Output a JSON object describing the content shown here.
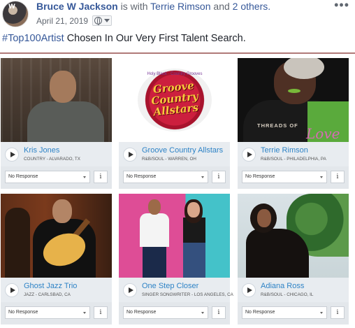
{
  "post": {
    "author": "Bruce W Jackson",
    "with_text": "is with",
    "tagged": "Terrie Rimson",
    "and_text": "and",
    "others": "2 others.",
    "date": "April 21, 2019",
    "hashtag": "#Top100Artist",
    "text": "Chosen In Our Very First Talent Search.",
    "privacy_icon": "globe-icon",
    "more_icon": "more-options-icon",
    "avatar_badge": "W"
  },
  "cards": [
    {
      "name": "Kris Jones",
      "sub": "COUNTRY - ALVARADO, TX",
      "response": "No Response",
      "info": "i"
    },
    {
      "name": "Groove Country Allstars",
      "sub": "R&B/SOUL - WARREN, OH",
      "response": "No Response",
      "info": "i",
      "logo_top": "Holy Black · Country Grooves",
      "logo_lines": [
        "Groove",
        "Country",
        "Allstars"
      ]
    },
    {
      "name": "Terrie Rimson",
      "sub": "R&B/SOUL - PHILADELPHIA, PA",
      "response": "No Response",
      "info": "i",
      "album_title": "THREADS OF",
      "album_script": "Love"
    },
    {
      "name": "Ghost Jazz Trio",
      "sub": "JAZZ - CARLSBAD, CA",
      "response": "No Response",
      "info": "i"
    },
    {
      "name": "One Step Closer",
      "sub": "SINGER SONGWRITER - LOS ANGELES, CA",
      "response": "No Response",
      "info": "i"
    },
    {
      "name": "Adiana Ross",
      "sub": "R&B/SOUL - CHICAGO, IL",
      "response": "No Response",
      "info": "i"
    }
  ],
  "colors": {
    "link": "#365899",
    "track": "#2e83c6",
    "divider": "#b07a78"
  }
}
